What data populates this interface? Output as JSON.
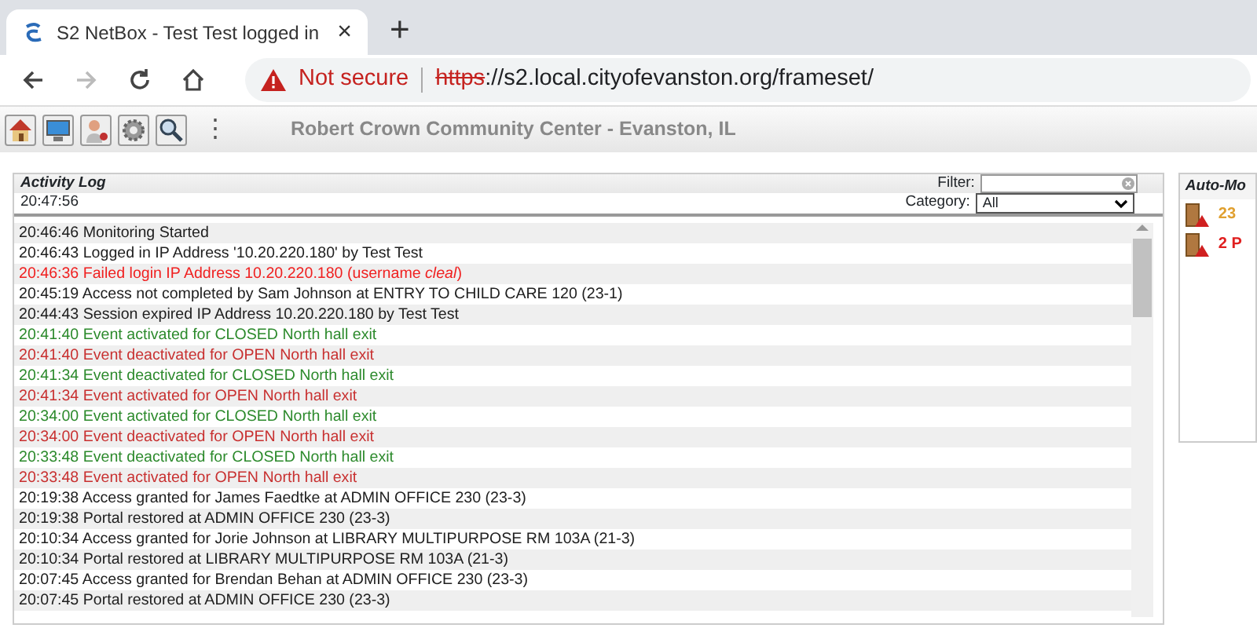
{
  "browser": {
    "tab": {
      "title": "S2 NetBox - Test Test logged in",
      "close": "×"
    },
    "new_tab": "+",
    "security": "Not secure",
    "url_scheme": "https",
    "url_rest": "://s2.local.cityofevanston.org/frameset/",
    "forward_disabled": true
  },
  "toolbar": {
    "more": "⋮",
    "site_title": "Robert Crown Community Center - Evanston, IL"
  },
  "activity_log": {
    "title": "Activity Log",
    "filter_label": "Filter:",
    "clock": "20:47:56",
    "category_label": "Category:",
    "category_value": "All",
    "rows": [
      {
        "text": "20:46:46 Monitoring Started",
        "color": "#202020"
      },
      {
        "text": "20:46:43 Logged in IP Address '10.20.220.180' by Test Test",
        "color": "#202020"
      },
      {
        "text": "20:46:36 Failed login IP Address 10.20.220.180 (username *cleal*)",
        "color": "#f02020"
      },
      {
        "text": "20:45:19 Access not completed by Sam Johnson at ENTRY TO CHILD CARE 120 (23-1)",
        "color": "#202020"
      },
      {
        "text": "20:44:43 Session expired IP Address 10.20.220.180 by Test Test",
        "color": "#202020"
      },
      {
        "text": "20:41:40 Event activated for CLOSED North hall exit",
        "color": "#2c8a2c"
      },
      {
        "text": "20:41:40 Event deactivated for OPEN North hall exit",
        "color": "#c83030"
      },
      {
        "text": "20:41:34 Event deactivated for CLOSED North hall exit",
        "color": "#2c8a2c"
      },
      {
        "text": "20:41:34 Event activated for OPEN North hall exit",
        "color": "#c83030"
      },
      {
        "text": "20:34:00 Event activated for CLOSED North hall exit",
        "color": "#2c8a2c"
      },
      {
        "text": "20:34:00 Event deactivated for OPEN North hall exit",
        "color": "#c83030"
      },
      {
        "text": "20:33:48 Event deactivated for CLOSED North hall exit",
        "color": "#2c8a2c"
      },
      {
        "text": "20:33:48 Event activated for OPEN North hall exit",
        "color": "#c83030"
      },
      {
        "text": "20:19:38 Access granted for James Faedtke at ADMIN OFFICE 230 (23-3)",
        "color": "#202020"
      },
      {
        "text": "20:19:38 Portal restored at ADMIN OFFICE 230 (23-3)",
        "color": "#202020"
      },
      {
        "text": "20:10:34 Access granted for Jorie Johnson at LIBRARY MULTIPURPOSE RM 103A (21-3)",
        "color": "#202020"
      },
      {
        "text": "20:10:34 Portal restored at LIBRARY MULTIPURPOSE RM 103A (21-3)",
        "color": "#202020"
      },
      {
        "text": "20:07:45 Access granted for Brendan Behan at ADMIN OFFICE 230 (23-3)",
        "color": "#202020"
      },
      {
        "text": "20:07:45 Portal restored at ADMIN OFFICE 230 (23-3)",
        "color": "#202020"
      }
    ]
  },
  "auto_monitor": {
    "title": "Auto-Mo",
    "items": [
      {
        "text": "23",
        "color": "#e0a030"
      },
      {
        "text": "2 P",
        "color": "#e02020"
      }
    ]
  }
}
